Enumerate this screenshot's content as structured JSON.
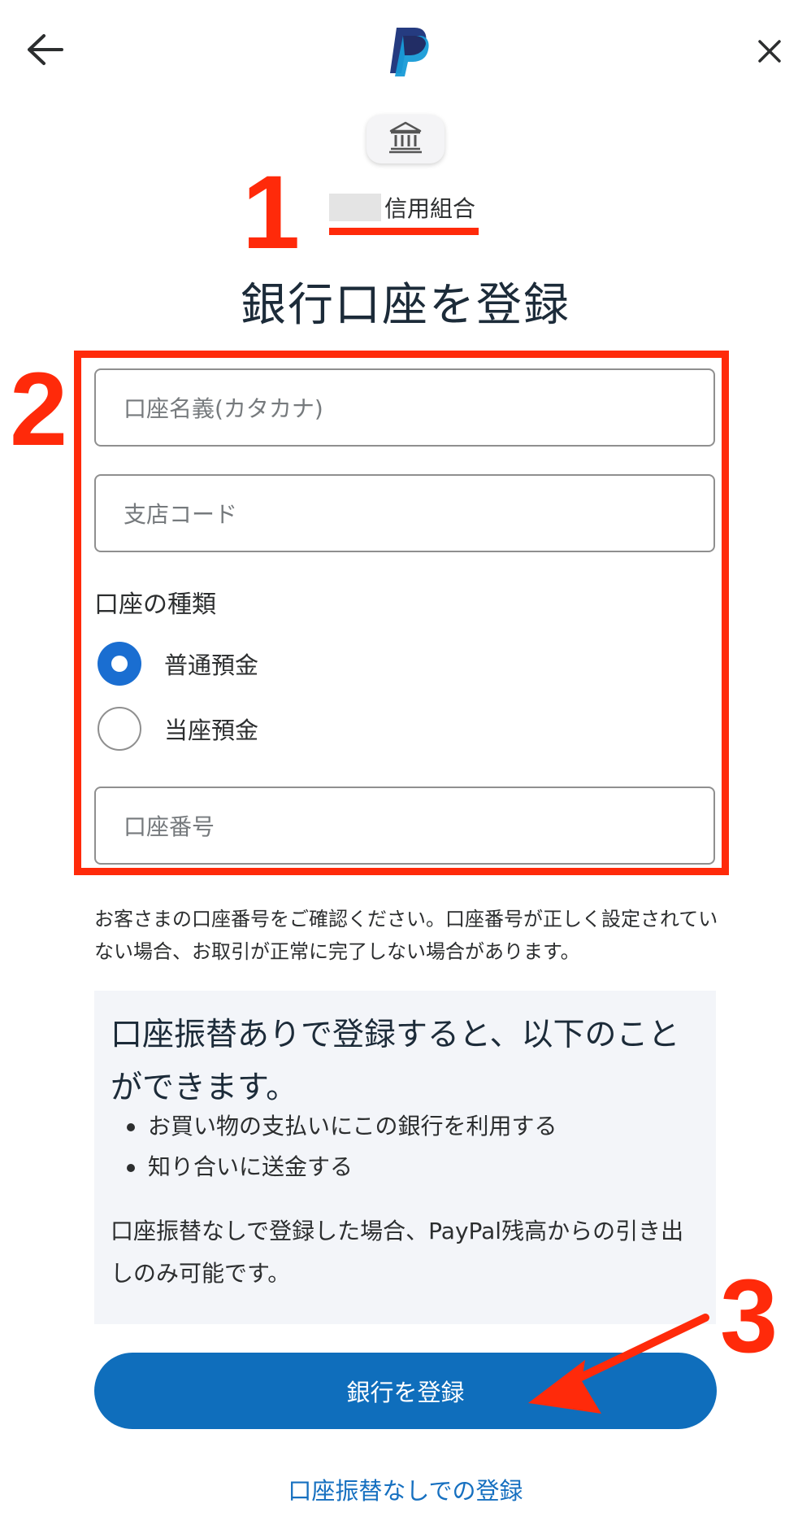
{
  "header": {
    "back_icon": "back-arrow-icon",
    "logo": "paypal-logo",
    "close_icon": "close-icon"
  },
  "bank": {
    "icon": "bank-building-icon",
    "name": "信用組合"
  },
  "title": "銀行口座を登録",
  "form": {
    "account_holder_placeholder": "口座名義(カタカナ)",
    "branch_code_placeholder": "支店コード",
    "account_type_label": "口座の種類",
    "account_type_options": [
      {
        "label": "普通預金",
        "selected": true
      },
      {
        "label": "当座預金",
        "selected": false
      }
    ],
    "account_number_placeholder": "口座番号"
  },
  "notice": "お客さまの口座番号をご確認ください。口座番号が正しく設定されていない場合、お取引が正常に完了しない場合があります。",
  "info": {
    "title": "口座振替ありで登録すると、以下のことができます。",
    "bullets": [
      "お買い物の支払いにこの銀行を利用する",
      "知り合いに送金する"
    ],
    "note": "口座振替なしで登録した場合、PayPal残高からの引き出しのみ可能です。"
  },
  "buttons": {
    "register": "銀行を登録",
    "register_without_transfer": "口座振替なしでの登録"
  },
  "annotations": {
    "step1": "1",
    "step2": "2",
    "step3": "3",
    "color": "#ff2a0a"
  },
  "colors": {
    "primary": "#0f6ebc",
    "radio_selected": "#1a6ed1",
    "link": "#1670c0",
    "info_bg": "#f3f5f9"
  }
}
